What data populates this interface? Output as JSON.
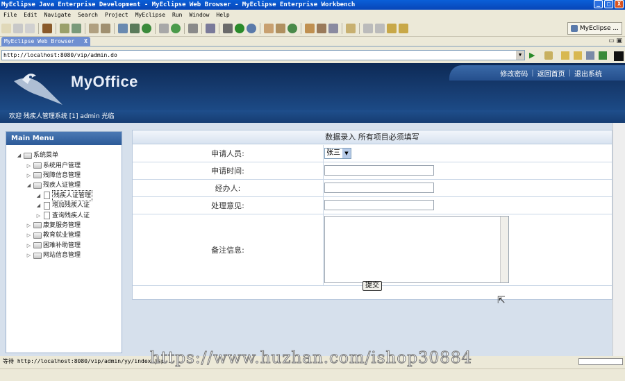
{
  "window": {
    "title": "MyEclipse Java Enterprise Development - MyEclipse Web Browser - MyEclipse Enterprise Workbench",
    "min_label": "_",
    "max_label": "□",
    "close_label": "X"
  },
  "menu": [
    "File",
    "Edit",
    "Navigate",
    "Search",
    "Project",
    "MyEclipse",
    "Run",
    "Window",
    "Help"
  ],
  "perspective": {
    "label": "MyEclipse ..."
  },
  "editor_tab": {
    "label": "MyEclipse Web Browser",
    "close": "X"
  },
  "address": {
    "url": "http://localhost:8080/vip/admin.do"
  },
  "page": {
    "logo": "MyOffice",
    "top_links": [
      "修改密码",
      "返回首页",
      "退出系统"
    ],
    "welcome": "欢迎 残疾人管理系统 [1] admin 光临"
  },
  "sidebar": {
    "title": "Main Menu",
    "root": "系统菜单",
    "items": [
      {
        "label": "系统用户管理",
        "level": 1,
        "type": "folder",
        "expander": "▷"
      },
      {
        "label": "残障信息管理",
        "level": 1,
        "type": "folder",
        "expander": "▷"
      },
      {
        "label": "残疾人证管理",
        "level": 1,
        "type": "folder",
        "expander": "◢"
      },
      {
        "label": "残疾人证管理",
        "level": 2,
        "type": "page",
        "expander": "◢",
        "selected": true
      },
      {
        "label": "增加残疾人证",
        "level": 2,
        "type": "page",
        "expander": "◢"
      },
      {
        "label": "查询残疾人证",
        "level": 2,
        "type": "page",
        "expander": "▷"
      },
      {
        "label": "康复服务管理",
        "level": 1,
        "type": "folder",
        "expander": "▷"
      },
      {
        "label": "教育就业管理",
        "level": 1,
        "type": "folder",
        "expander": "▷"
      },
      {
        "label": "困难补助管理",
        "level": 1,
        "type": "folder",
        "expander": "▷"
      },
      {
        "label": "网站信息管理",
        "level": 1,
        "type": "folder",
        "expander": "▷"
      }
    ]
  },
  "form": {
    "title": "数据录入 所有项目必须填写",
    "applicant_label": "申请人员:",
    "applicant_value": "张三",
    "date_label": "申请时间:",
    "handler_label": "经办人:",
    "opinion_label": "处理意见:",
    "notes_label": "备注信息:",
    "submit": "提交"
  },
  "status": {
    "text": "等待 http://localhost:8080/vip/admin/yy/index.jsp..."
  },
  "watermark": "https://www.huzhan.com/ishop30884"
}
